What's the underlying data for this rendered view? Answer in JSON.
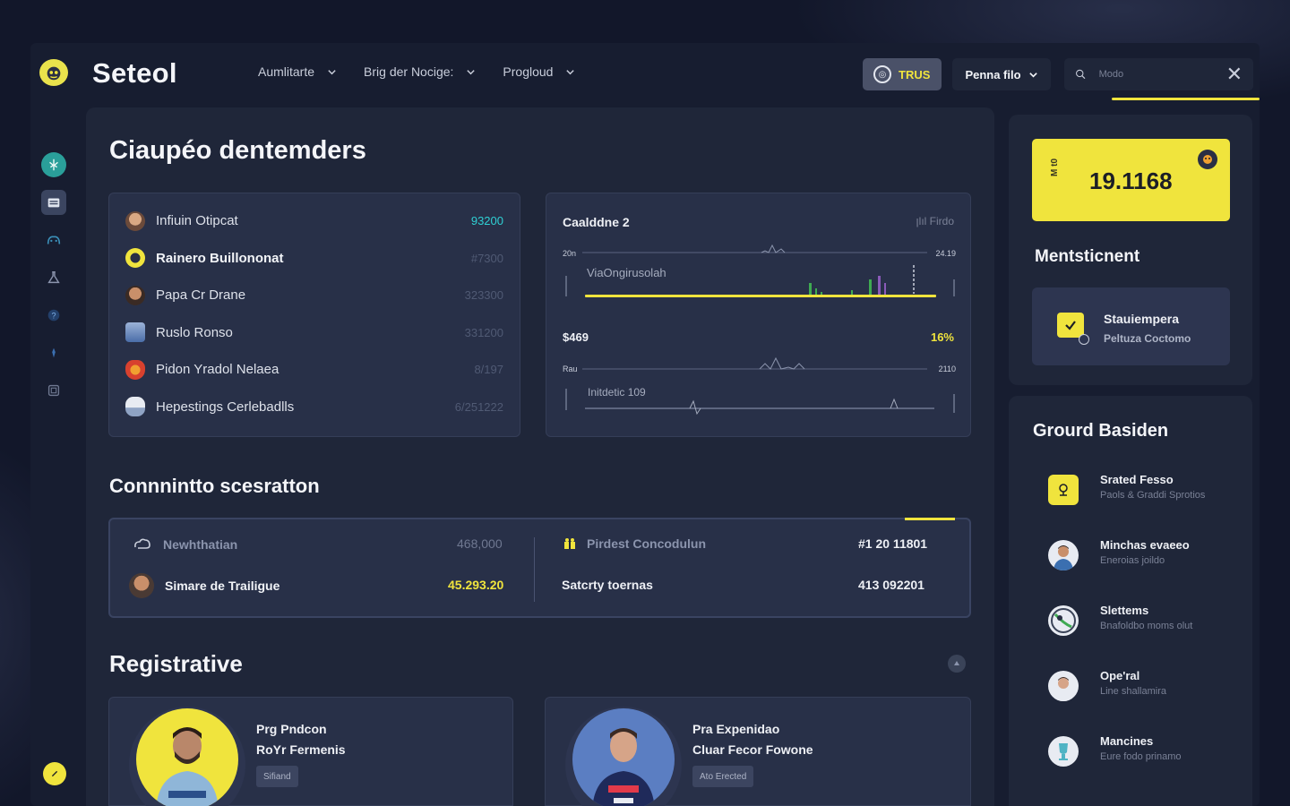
{
  "app": {
    "brand": "Seteol"
  },
  "nav": {
    "links": [
      "Aumlitarte",
      "Brig der Nocige:",
      "Progloud"
    ],
    "trust_label": "TRUS",
    "profile_label": "Penna filo",
    "search_placeholder": "Modo"
  },
  "sidebar": {
    "icons": [
      "leaf-icon",
      "folder-icon",
      "cat-icon",
      "flask-icon",
      "question-icon",
      "torch-icon",
      "box-icon"
    ],
    "bottom_icon": "compass-icon"
  },
  "main": {
    "title": "Ciaupéo dentemders",
    "players": [
      {
        "name": "Infiuin Otipcat",
        "value": "93200",
        "highlight": true
      },
      {
        "name": "Rainero Buillononat",
        "value": "#7300",
        "highlight": false
      },
      {
        "name": "Papa Cr Drane",
        "value": "323300",
        "highlight": false
      },
      {
        "name": "Ruslo Ronso",
        "value": "331200",
        "highlight": false
      },
      {
        "name": "Pidon Yradol Nelaea",
        "value": "8/197",
        "highlight": false
      },
      {
        "name": "Hepestings Cerlebadlls",
        "value": "6/251222",
        "highlight": false
      }
    ],
    "chart": {
      "title": "Caalddne 2",
      "meta": "ꞁlıl Firdo",
      "top_left_tick": "20n",
      "top_right_tick": "24.19",
      "top_label": "ViaOngirusolah",
      "price": "$469",
      "percent": "16%",
      "bottom_left_tick": "Rau",
      "bottom_right_tick": "2110",
      "bottom_label": "Initdetic 109"
    },
    "section2_title": "Connnintto scesratton",
    "conversions": {
      "left": [
        {
          "label": "Newhthatian",
          "value": "468,000"
        },
        {
          "label": "Simare de Trailigue",
          "value": "45.293.20"
        }
      ],
      "right": [
        {
          "label": "Pirdest Concodulun",
          "value": "#1 20 11801"
        },
        {
          "label": "Satcrty toernas",
          "value": "413 092201"
        }
      ]
    },
    "section3_title": "Registrative",
    "registrations": [
      {
        "title": "Prg Pndcon",
        "subtitle": "RoYr Fermenis",
        "tag": "Sifiand"
      },
      {
        "title": "Pra Expenidao",
        "subtitle": "Cluar Fecor Fowone",
        "tag": "Ato Erected"
      }
    ]
  },
  "right": {
    "balance_side": "M t0",
    "balance": "19.1168",
    "mention_title": "Mentsticnent",
    "mention_card": {
      "title": "Stauiempera",
      "subtitle": "Peltuza Coctomo"
    },
    "ground_title": "Grourd Basiden",
    "ground_items": [
      {
        "name": "Srated Fesso",
        "sub": "Paols & Graddi Sprotios",
        "icon": "trophy-icon"
      },
      {
        "name": "Minchas evaeeo",
        "sub": "Eneroias joildo",
        "icon": "player-avatar"
      },
      {
        "name": "Slettems",
        "sub": "Bnafoldbo moms olut",
        "icon": "ball-icon"
      },
      {
        "name": "Ope'ral",
        "sub": "Line shallamira",
        "icon": "player-avatar"
      },
      {
        "name": "Mancines",
        "sub": "Eure fodo prinamo",
        "icon": "cup-icon"
      }
    ]
  },
  "colors": {
    "accent": "#f0e43d",
    "teal": "#2fd0d4",
    "bg": "#12172a",
    "panel": "#1f2639",
    "card": "#283048"
  }
}
